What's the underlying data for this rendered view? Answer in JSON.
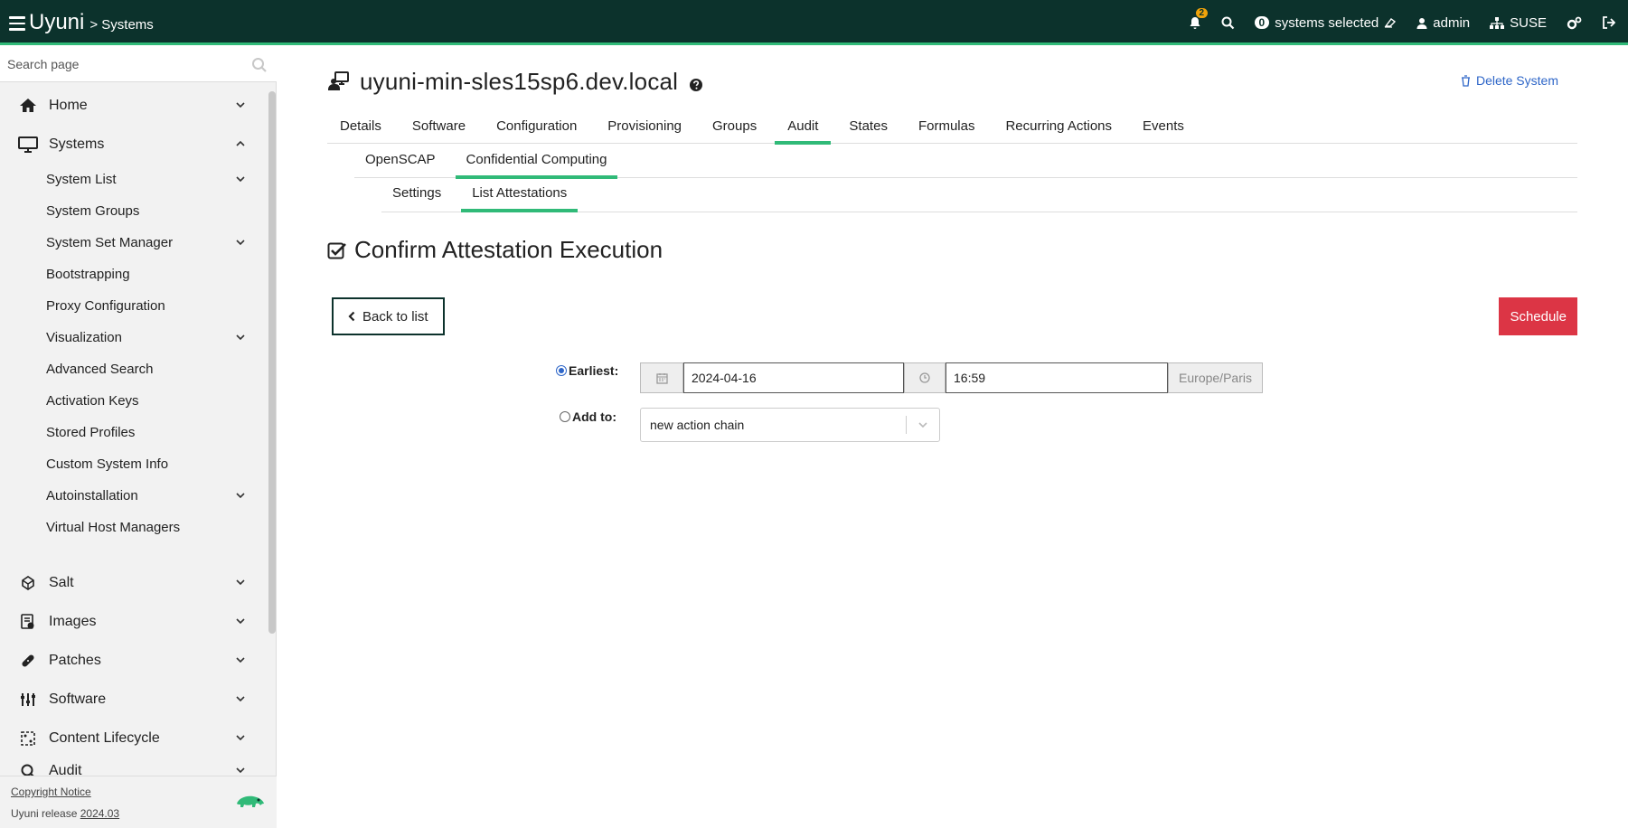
{
  "header": {
    "brand": "Uyuni",
    "breadcrumb": "> Systems",
    "notifications_count": "2",
    "systems_selected_count": "0",
    "systems_selected_label": "systems selected",
    "user": "admin",
    "org": "SUSE"
  },
  "sidebar": {
    "search_placeholder": "Search page",
    "items": [
      {
        "label": "Home",
        "icon": "home-icon"
      },
      {
        "label": "Systems",
        "icon": "monitor-icon",
        "expanded": true
      },
      {
        "label": "Salt",
        "icon": "salt-icon"
      },
      {
        "label": "Images",
        "icon": "images-icon"
      },
      {
        "label": "Patches",
        "icon": "patches-icon"
      },
      {
        "label": "Software",
        "icon": "software-icon"
      },
      {
        "label": "Content Lifecycle",
        "icon": "lifecycle-icon"
      },
      {
        "label": "Audit",
        "icon": "audit-icon"
      }
    ],
    "systems_sub": [
      "System List",
      "System Groups",
      "System Set Manager",
      "Bootstrapping",
      "Proxy Configuration",
      "Visualization",
      "Advanced Search",
      "Activation Keys",
      "Stored Profiles",
      "Custom System Info",
      "Autoinstallation",
      "Virtual Host Managers"
    ],
    "footer": {
      "copyright": "Copyright Notice",
      "release_prefix": "Uyuni release",
      "release_version": "2024.03"
    }
  },
  "main": {
    "system_name": "uyuni-min-sles15sp6.dev.local",
    "delete_label": "Delete System",
    "tabs": [
      "Details",
      "Software",
      "Configuration",
      "Provisioning",
      "Groups",
      "Audit",
      "States",
      "Formulas",
      "Recurring Actions",
      "Events"
    ],
    "active_tab": "Audit",
    "subtabs": [
      "OpenSCAP",
      "Confidential Computing"
    ],
    "active_subtab": "Confidential Computing",
    "subtabs2": [
      "Settings",
      "List Attestations"
    ],
    "active_subtab2": "List Attestations",
    "section_title": "Confirm Attestation Execution",
    "back_label": "Back to list",
    "schedule_label": "Schedule",
    "earliest_label": "Earliest:",
    "date_value": "2024-04-16",
    "time_value": "16:59",
    "timezone": "Europe/Paris",
    "addto_label": "Add to:",
    "action_chain": "new action chain"
  },
  "colors": {
    "header_bg": "#0c322c",
    "accent": "#30ba78",
    "schedule": "#dc3545",
    "link": "#2e66c8"
  }
}
